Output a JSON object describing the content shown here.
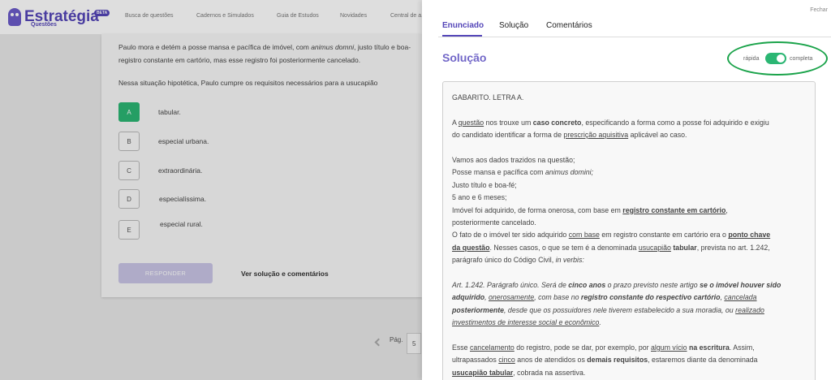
{
  "topbar": {
    "logo_text": "Estratégia",
    "logo_sub": "Questões",
    "beta": "BETA",
    "nav": [
      "Busca de questões",
      "Cadernos e Simulados",
      "Guia de Estudos",
      "Novidades",
      "Central de a..."
    ]
  },
  "question": {
    "text_a1": "Paulo mora e detém a posse mansa e pacífica de imóvel, com ",
    "text_a_italic": "animus domni",
    "text_a2": ", justo título e boa-",
    "text_b": "registro constante em cartório, mas esse registro foi posteriormente cancelado.",
    "prompt": "Nessa situação hipotética, Paulo cumpre os requisitos necessários para a usucapião",
    "options": [
      {
        "letter": "A",
        "label": "tabular."
      },
      {
        "letter": "B",
        "label": "especial urbana."
      },
      {
        "letter": "C",
        "label": "extraordinária."
      },
      {
        "letter": "D",
        "label": "especialíssima."
      },
      {
        "letter": "E",
        "label": "especial rural."
      }
    ],
    "answer_button": "RESPONDER",
    "see_solution": "Ver solução e comentários"
  },
  "pager": {
    "label": "Pág.",
    "page": "5"
  },
  "panel": {
    "close": "Fechar",
    "tabs": [
      "Enunciado",
      "Solução",
      "Comentários"
    ],
    "title": "Solução",
    "toggle_left": "rápida",
    "toggle_right": "completa",
    "accent": "#5446b8",
    "highlight": "#1aa34a"
  },
  "solution": {
    "gabarito": "GABARITO. LETRA A.",
    "p1": [
      "A ",
      "questão",
      " nos trouxe um ",
      "caso concreto",
      ", especificando a forma como a posse foi adquirido e exigiu",
      "do candidato identificar a forma de ",
      "prescrição aquisitiva",
      " aplicável ao caso."
    ],
    "data_intro": "Vamos aos dados trazidos na questão;",
    "data1a": "Posse mansa e pacífica com ",
    "data1b": "animus domini;",
    "data2": "Justo título e boa-fé;",
    "data3": "5 ano e 6 meses;",
    "data4": [
      "Imóvel foi adquirido, de forma onerosa, com base em ",
      "registro constante em cartório",
      ","
    ],
    "data5": "posteriormente cancelado.",
    "p2": [
      "O fato de o imóvel ter sido adquirido ",
      "com base",
      " em registro constante em cartório era o ",
      "ponto chave",
      "da questão",
      ". Nesses casos, o que se tem é a denominada ",
      "usucapião",
      " tabular",
      ", prevista no art. 1.242,",
      "parágrafo único do Código Civil, ",
      "in verbis:"
    ],
    "art": [
      "Art. 1.242. Parágrafo único. Será de ",
      "cinco anos",
      " o prazo previsto neste artigo ",
      "se o imóvel houver sido",
      "adquirido",
      ", ",
      "onerosamente",
      ", com base no ",
      "registro constante do respectivo cartório",
      ", ",
      "cancelada",
      "posteriormente",
      ", desde que os possuidores nele tiverem estabelecido a sua moradia",
      ", ou ",
      "realizado",
      "investimentos de interesse social e econômico",
      "."
    ],
    "p3": [
      "Esse ",
      "cancelamento",
      " do registro, pode se dar, por exemplo, por ",
      "algum vício",
      " na escritura",
      ". Assim,",
      "ultrapassados ",
      "cinco",
      " anos de atendidos os ",
      "demais requisitos",
      ", estaremos diante da denominada",
      "usucapião tabular",
      ", cobrada na assertiva."
    ]
  }
}
